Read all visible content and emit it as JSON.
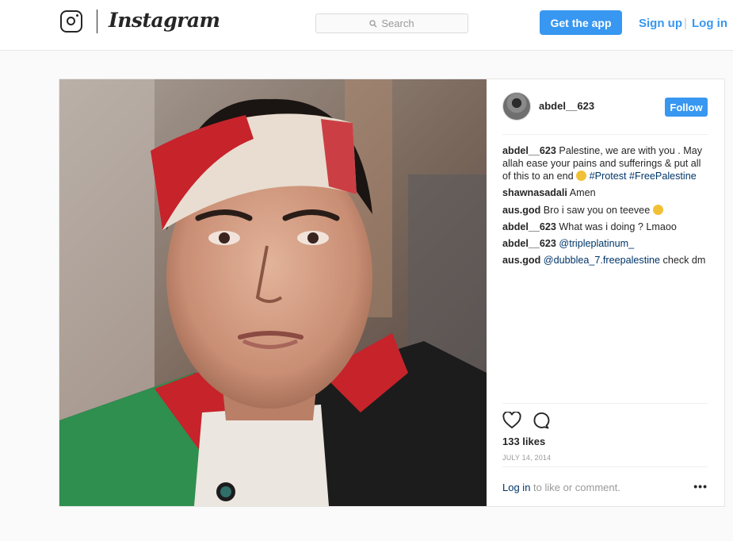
{
  "header": {
    "brand": "Instagram",
    "search_placeholder": "Search",
    "get_app_label": "Get the app",
    "sign_up_label": "Sign up",
    "separator": "|",
    "log_in_label": "Log in"
  },
  "post": {
    "username": "abdel__623",
    "follow_label": "Follow",
    "comments": [
      {
        "user": "abdel__623",
        "text": "Palestine, we are with you . May allah ease your pains and sufferings & put all of this to an end",
        "tags": "#Protest #FreePalestine",
        "emoji": "pensive-face-emoji"
      },
      {
        "user": "shawnasadali",
        "text": "Amen"
      },
      {
        "user": "aus.god",
        "text": "Bro i saw you on teevee",
        "emoji": "laughing-face-emoji"
      },
      {
        "user": "abdel__623",
        "text": "What was i doing ? Lmaoo"
      },
      {
        "user": "abdel__623",
        "mention": "@tripleplatinum_"
      },
      {
        "user": "aus.god",
        "mention": "@dubblea_7.freepalestine",
        "text": "check dm"
      }
    ],
    "likes": "133 likes",
    "date": "JULY 14, 2014",
    "footer_login": "Log in",
    "footer_text": " to like or comment.",
    "more_label": "•••"
  },
  "colors": {
    "accent": "#3897f0",
    "link": "#003569",
    "muted": "#999999"
  },
  "icons": [
    "instagram-camera-icon",
    "search-icon",
    "heart-icon",
    "comment-icon",
    "more-options-icon"
  ]
}
